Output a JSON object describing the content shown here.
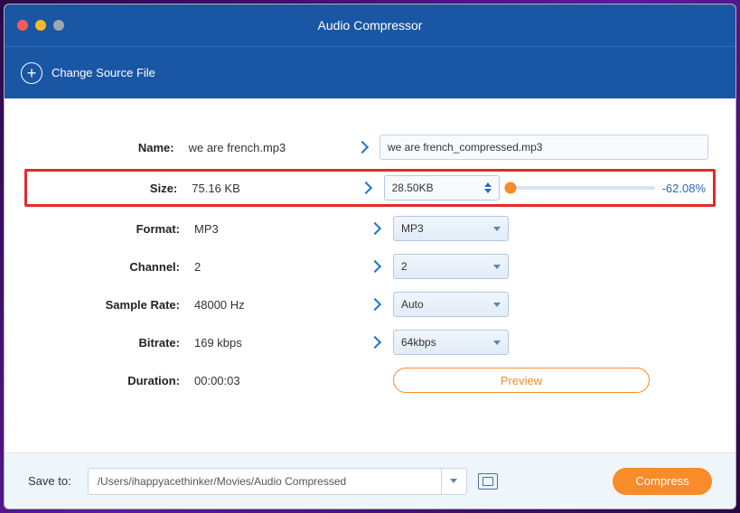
{
  "window": {
    "title": "Audio Compressor"
  },
  "toolbar": {
    "change_source": "Change Source File"
  },
  "rows": {
    "name": {
      "label": "Name:",
      "left": "we are french.mp3",
      "right": "we are french_compressed.mp3"
    },
    "size": {
      "label": "Size:",
      "left": "75.16 KB",
      "right": "28.50KB",
      "percent": "-62.08%"
    },
    "format": {
      "label": "Format:",
      "left": "MP3",
      "right": "MP3"
    },
    "channel": {
      "label": "Channel:",
      "left": "2",
      "right": "2"
    },
    "sample_rate": {
      "label": "Sample Rate:",
      "left": "48000 Hz",
      "right": "Auto"
    },
    "bitrate": {
      "label": "Bitrate:",
      "left": "169 kbps",
      "right": "64kbps"
    },
    "duration": {
      "label": "Duration:",
      "left": "00:00:03"
    }
  },
  "buttons": {
    "preview": "Preview",
    "compress": "Compress"
  },
  "footer": {
    "save_label": "Save to:",
    "path": "/Users/ihappyacethinker/Movies/Audio Compressed"
  }
}
